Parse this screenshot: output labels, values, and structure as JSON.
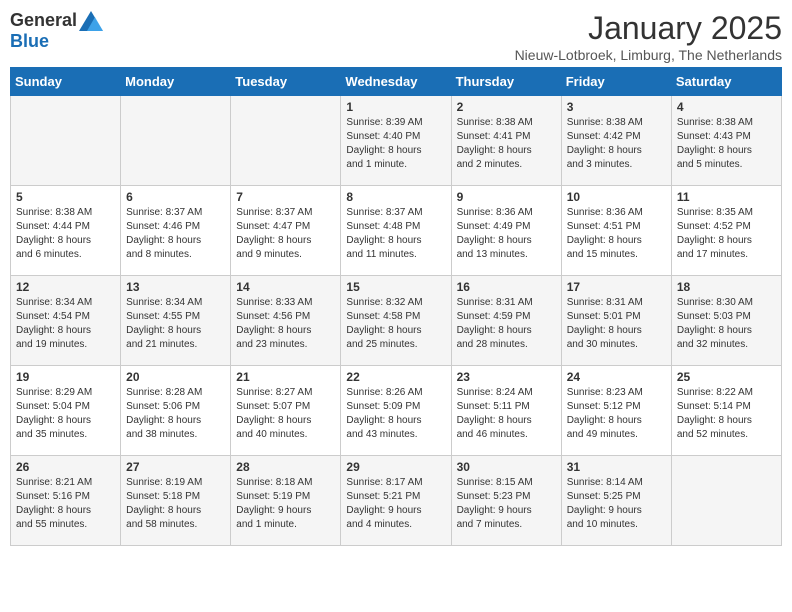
{
  "header": {
    "logo_general": "General",
    "logo_blue": "Blue",
    "month": "January 2025",
    "location": "Nieuw-Lotbroek, Limburg, The Netherlands"
  },
  "days_of_week": [
    "Sunday",
    "Monday",
    "Tuesday",
    "Wednesday",
    "Thursday",
    "Friday",
    "Saturday"
  ],
  "weeks": [
    [
      {
        "day": "",
        "info": ""
      },
      {
        "day": "",
        "info": ""
      },
      {
        "day": "",
        "info": ""
      },
      {
        "day": "1",
        "info": "Sunrise: 8:39 AM\nSunset: 4:40 PM\nDaylight: 8 hours\nand 1 minute."
      },
      {
        "day": "2",
        "info": "Sunrise: 8:38 AM\nSunset: 4:41 PM\nDaylight: 8 hours\nand 2 minutes."
      },
      {
        "day": "3",
        "info": "Sunrise: 8:38 AM\nSunset: 4:42 PM\nDaylight: 8 hours\nand 3 minutes."
      },
      {
        "day": "4",
        "info": "Sunrise: 8:38 AM\nSunset: 4:43 PM\nDaylight: 8 hours\nand 5 minutes."
      }
    ],
    [
      {
        "day": "5",
        "info": "Sunrise: 8:38 AM\nSunset: 4:44 PM\nDaylight: 8 hours\nand 6 minutes."
      },
      {
        "day": "6",
        "info": "Sunrise: 8:37 AM\nSunset: 4:46 PM\nDaylight: 8 hours\nand 8 minutes."
      },
      {
        "day": "7",
        "info": "Sunrise: 8:37 AM\nSunset: 4:47 PM\nDaylight: 8 hours\nand 9 minutes."
      },
      {
        "day": "8",
        "info": "Sunrise: 8:37 AM\nSunset: 4:48 PM\nDaylight: 8 hours\nand 11 minutes."
      },
      {
        "day": "9",
        "info": "Sunrise: 8:36 AM\nSunset: 4:49 PM\nDaylight: 8 hours\nand 13 minutes."
      },
      {
        "day": "10",
        "info": "Sunrise: 8:36 AM\nSunset: 4:51 PM\nDaylight: 8 hours\nand 15 minutes."
      },
      {
        "day": "11",
        "info": "Sunrise: 8:35 AM\nSunset: 4:52 PM\nDaylight: 8 hours\nand 17 minutes."
      }
    ],
    [
      {
        "day": "12",
        "info": "Sunrise: 8:34 AM\nSunset: 4:54 PM\nDaylight: 8 hours\nand 19 minutes."
      },
      {
        "day": "13",
        "info": "Sunrise: 8:34 AM\nSunset: 4:55 PM\nDaylight: 8 hours\nand 21 minutes."
      },
      {
        "day": "14",
        "info": "Sunrise: 8:33 AM\nSunset: 4:56 PM\nDaylight: 8 hours\nand 23 minutes."
      },
      {
        "day": "15",
        "info": "Sunrise: 8:32 AM\nSunset: 4:58 PM\nDaylight: 8 hours\nand 25 minutes."
      },
      {
        "day": "16",
        "info": "Sunrise: 8:31 AM\nSunset: 4:59 PM\nDaylight: 8 hours\nand 28 minutes."
      },
      {
        "day": "17",
        "info": "Sunrise: 8:31 AM\nSunset: 5:01 PM\nDaylight: 8 hours\nand 30 minutes."
      },
      {
        "day": "18",
        "info": "Sunrise: 8:30 AM\nSunset: 5:03 PM\nDaylight: 8 hours\nand 32 minutes."
      }
    ],
    [
      {
        "day": "19",
        "info": "Sunrise: 8:29 AM\nSunset: 5:04 PM\nDaylight: 8 hours\nand 35 minutes."
      },
      {
        "day": "20",
        "info": "Sunrise: 8:28 AM\nSunset: 5:06 PM\nDaylight: 8 hours\nand 38 minutes."
      },
      {
        "day": "21",
        "info": "Sunrise: 8:27 AM\nSunset: 5:07 PM\nDaylight: 8 hours\nand 40 minutes."
      },
      {
        "day": "22",
        "info": "Sunrise: 8:26 AM\nSunset: 5:09 PM\nDaylight: 8 hours\nand 43 minutes."
      },
      {
        "day": "23",
        "info": "Sunrise: 8:24 AM\nSunset: 5:11 PM\nDaylight: 8 hours\nand 46 minutes."
      },
      {
        "day": "24",
        "info": "Sunrise: 8:23 AM\nSunset: 5:12 PM\nDaylight: 8 hours\nand 49 minutes."
      },
      {
        "day": "25",
        "info": "Sunrise: 8:22 AM\nSunset: 5:14 PM\nDaylight: 8 hours\nand 52 minutes."
      }
    ],
    [
      {
        "day": "26",
        "info": "Sunrise: 8:21 AM\nSunset: 5:16 PM\nDaylight: 8 hours\nand 55 minutes."
      },
      {
        "day": "27",
        "info": "Sunrise: 8:19 AM\nSunset: 5:18 PM\nDaylight: 8 hours\nand 58 minutes."
      },
      {
        "day": "28",
        "info": "Sunrise: 8:18 AM\nSunset: 5:19 PM\nDaylight: 9 hours\nand 1 minute."
      },
      {
        "day": "29",
        "info": "Sunrise: 8:17 AM\nSunset: 5:21 PM\nDaylight: 9 hours\nand 4 minutes."
      },
      {
        "day": "30",
        "info": "Sunrise: 8:15 AM\nSunset: 5:23 PM\nDaylight: 9 hours\nand 7 minutes."
      },
      {
        "day": "31",
        "info": "Sunrise: 8:14 AM\nSunset: 5:25 PM\nDaylight: 9 hours\nand 10 minutes."
      },
      {
        "day": "",
        "info": ""
      }
    ]
  ]
}
